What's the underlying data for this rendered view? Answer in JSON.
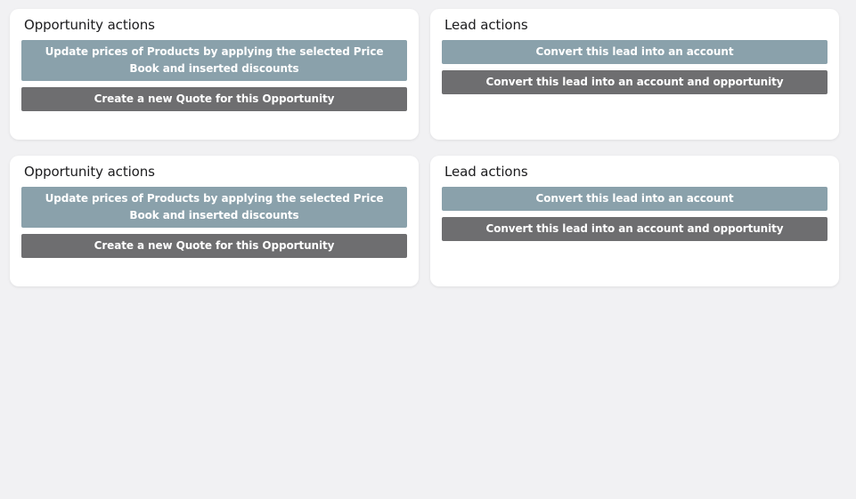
{
  "colors": {
    "background": "#f1f1f3",
    "card": "#ffffff",
    "primary_button": "#8aa1ab",
    "secondary_button": "#6e6e70"
  },
  "cards": [
    {
      "title": "Opportunity actions",
      "buttons": [
        "Update prices of Products by applying the selected Price Book and inserted discounts",
        "Create a new Quote for this Opportunity"
      ]
    },
    {
      "title": "Lead actions",
      "buttons": [
        "Convert this lead into an account",
        "Convert this lead into an account and opportunity"
      ]
    },
    {
      "title": "Opportunity actions",
      "buttons": [
        "Update prices of Products by applying the selected Price Book and inserted discounts",
        "Create a new Quote for this Opportunity"
      ]
    },
    {
      "title": "Lead actions",
      "buttons": [
        "Convert this lead into an account",
        "Convert this lead into an account and opportunity"
      ]
    }
  ]
}
